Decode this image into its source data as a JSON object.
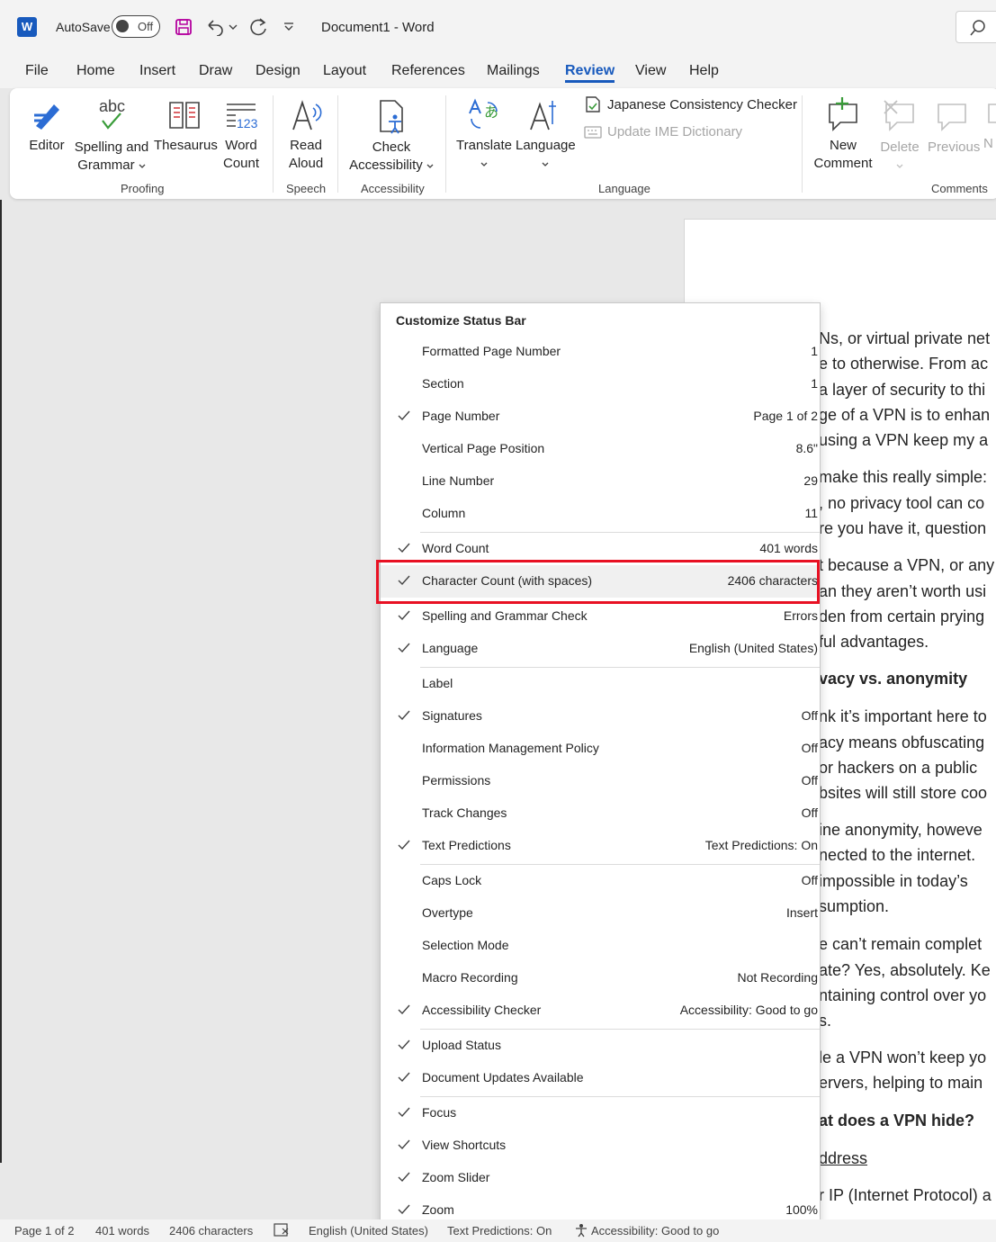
{
  "titlebar": {
    "app_icon": "word-logo",
    "autosave_label": "AutoSave",
    "autosave_state": "Off",
    "document_title": "Document1  -  Word"
  },
  "tabs": [
    "File",
    "Home",
    "Insert",
    "Draw",
    "Design",
    "Layout",
    "References",
    "Mailings",
    "Review",
    "View",
    "Help"
  ],
  "active_tab": "Review",
  "ribbon": {
    "editor": "Editor",
    "spelling_line1": "Spelling and",
    "spelling_line2": "Grammar",
    "thesaurus": "Thesaurus",
    "word_count_line1": "Word",
    "word_count_line2": "Count",
    "read_aloud_line1": "Read",
    "read_aloud_line2": "Aloud",
    "check_acc_line1": "Check",
    "check_acc_line2": "Accessibility",
    "translate": "Translate",
    "language": "Language",
    "japanese_checker": "Japanese Consistency Checker",
    "update_ime": "Update IME Dictionary",
    "new_comment_line1": "New",
    "new_comment_line2": "Comment",
    "delete": "Delete",
    "previous": "Previous",
    "next_partial": "N",
    "groups": {
      "proofing": "Proofing",
      "speech": "Speech",
      "accessibility": "Accessibility",
      "language": "Language",
      "comments": "Comments"
    }
  },
  "document_lines": [
    "Ns, or virtual private net",
    "e to otherwise. From ac",
    "a layer of security to thi",
    "ge of a VPN is to enhan",
    " using a VPN keep my a",
    "make this really simple:",
    ", no privacy tool can co",
    "re you have it, question",
    "t because a VPN, or any",
    "an they aren’t worth usi",
    "den from certain prying",
    "ful advantages.",
    "vacy vs. anonymity",
    "nk it’s important here to",
    "acy means obfuscating",
    "or hackers on a public ",
    "bsites will still store coo",
    "ine anonymity, howeve",
    "nected to the internet.",
    " impossible in today’s ",
    "sumption.",
    "e can’t remain complet",
    "ate? Yes, absolutely. Ke",
    "ntaining control over yo",
    "s.",
    "le a VPN won’t keep yo",
    "ervers, helping to main",
    "at does a VPN hide?",
    "ddress",
    "r IP (Internet Protocol) a"
  ],
  "menu": {
    "title": "Customize Status Bar",
    "items": [
      {
        "label": "Formatted Page Number",
        "value": "1",
        "checked": false
      },
      {
        "label": "Section",
        "value": "1",
        "checked": false
      },
      {
        "label": "Page Number",
        "value": "Page 1 of 2",
        "checked": true
      },
      {
        "label": "Vertical Page Position",
        "value": "8.6\"",
        "checked": false
      },
      {
        "label": "Line Number",
        "value": "29",
        "checked": false
      },
      {
        "label": "Column",
        "value": "11",
        "checked": false
      },
      {
        "label": "Word Count",
        "value": "401 words",
        "checked": true
      },
      {
        "label": "Character Count (with spaces)",
        "value": "2406 characters",
        "checked": true
      },
      {
        "label": "Spelling and Grammar Check",
        "value": "Errors",
        "checked": true
      },
      {
        "label": "Language",
        "value": "English (United States)",
        "checked": true
      },
      {
        "label": "Label",
        "value": "",
        "checked": false
      },
      {
        "label": "Signatures",
        "value": "Off",
        "checked": true
      },
      {
        "label": "Information Management Policy",
        "value": "Off",
        "checked": false
      },
      {
        "label": "Permissions",
        "value": "Off",
        "checked": false
      },
      {
        "label": "Track Changes",
        "value": "Off",
        "checked": false
      },
      {
        "label": "Text Predictions",
        "value": "Text Predictions: On",
        "checked": true
      },
      {
        "label": "Caps Lock",
        "value": "Off",
        "checked": false
      },
      {
        "label": "Overtype",
        "value": "Insert",
        "checked": false
      },
      {
        "label": "Selection Mode",
        "value": "",
        "checked": false
      },
      {
        "label": "Macro Recording",
        "value": "Not Recording",
        "checked": false
      },
      {
        "label": "Accessibility Checker",
        "value": "Accessibility: Good to go",
        "checked": true
      },
      {
        "label": "Upload Status",
        "value": "",
        "checked": true
      },
      {
        "label": "Document Updates Available",
        "value": "",
        "checked": true
      },
      {
        "label": "Focus",
        "value": "",
        "checked": true
      },
      {
        "label": "View Shortcuts",
        "value": "",
        "checked": true
      },
      {
        "label": "Zoom Slider",
        "value": "",
        "checked": true
      },
      {
        "label": "Zoom",
        "value": "100%",
        "checked": true
      }
    ]
  },
  "statusbar": {
    "page": "Page 1 of 2",
    "words": "401 words",
    "characters": "2406 characters",
    "language": "English (United States)",
    "text_predictions": "Text Predictions: On",
    "accessibility": "Accessibility: Good to go"
  },
  "colors": {
    "accent": "#185abd",
    "highlight_box": "#e81123",
    "word_brand": "#185abd"
  }
}
